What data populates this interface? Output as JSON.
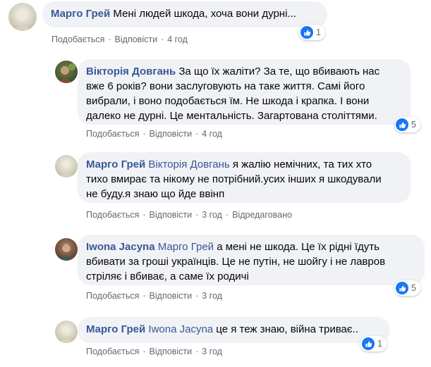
{
  "comments": [
    {
      "author": "Марго Грей",
      "text": "Мені людей шкода, хоча вони дурні...",
      "like": "Подобається",
      "reply": "Відповісти",
      "time": "4 год",
      "reactions": "1",
      "avatar": "margo-avatar"
    },
    {
      "author": "Вікторія Довгань",
      "text": "За що їх жаліти? За те, що вбивають нас вже 6 років? вони заслуговують на таке життя. Самі його вибрали, і воно подобається їм. Не шкода і крапка. І вони далеко не дурні. Це ментальність. Загартована століттями.",
      "lines": [
        "За що їх жаліти? За те, що вбивають нас",
        "вже 6 років? вони заслуговують на таке життя. Самі його",
        "вибрали, і воно подобається їм. Не шкода і крапка. І вони",
        "далеко не дурні. Це ментальність. Загартована століттями."
      ],
      "like": "Подобається",
      "reply": "Відповісти",
      "time": "4 год",
      "reactions": "5",
      "avatar": "viktoria-avatar"
    },
    {
      "author": "Марго Грей",
      "mention": "Вікторія Довгань",
      "lines": [
        " я жалію немічних, та тих хто",
        "тихо вмирає та нікому не потрібний.усих інших я шкодували",
        "не буду.я знаю що йде ввінп"
      ],
      "like": "Подобається",
      "reply": "Відповісти",
      "time": "3 год",
      "edited": "Відредаговано",
      "avatar": "margo-avatar"
    },
    {
      "author": "Iwona Jacyna",
      "mention": "Марго Грей",
      "lines": [
        " а мені не шкода. Це їх рідні їдуть",
        "вбивати за гроші українців. Це не путін, не шойгу і не лавров",
        "стріляє і вбиває, а саме їх родичі"
      ],
      "like": "Подобається",
      "reply": "Відповісти",
      "time": "3 год",
      "reactions": "5",
      "avatar": "iwona-avatar"
    },
    {
      "author": "Марго Грей",
      "mention": "Iwona Jacyna",
      "text": " це я теж знаю, війна триває..",
      "like": "Подобається",
      "reply": "Відповісти",
      "time": "3 год",
      "reactions": "1",
      "avatar": "margo-avatar"
    }
  ],
  "colors": {
    "link": "#385898",
    "bubble": "#f0f2f5",
    "meta": "#65676b",
    "like": "#1877f2"
  }
}
